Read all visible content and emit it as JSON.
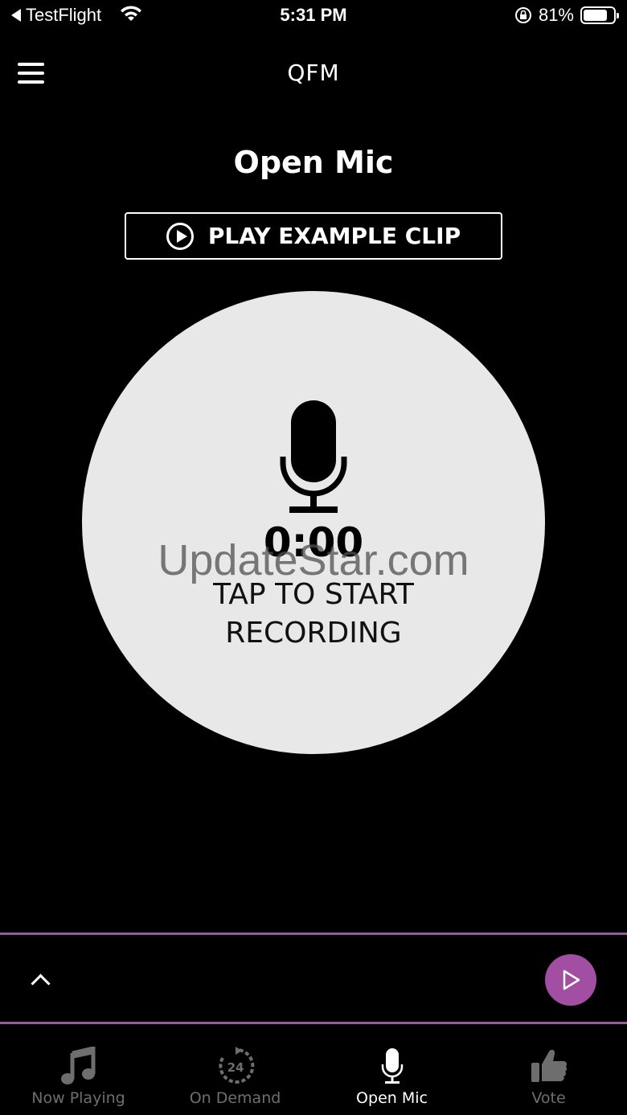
{
  "status_bar": {
    "back_app": "TestFlight",
    "time": "5:31 PM",
    "battery": "81%",
    "battery_level": 0.81
  },
  "nav": {
    "title": "QFM"
  },
  "page": {
    "title": "Open Mic",
    "example_button": "PLAY EXAMPLE CLIP",
    "timer": "0:00",
    "tap_line1": "TAP TO START",
    "tap_line2": "RECORDING",
    "watermark": "UpdateStar.com"
  },
  "tabs": [
    {
      "label": "Now Playing",
      "icon": "music-note-icon",
      "active": false
    },
    {
      "label": "On Demand",
      "icon": "on-demand-24-icon",
      "active": false
    },
    {
      "label": "Open Mic",
      "icon": "microphone-icon",
      "active": true
    },
    {
      "label": "Vote",
      "icon": "thumbs-up-icon",
      "active": false
    }
  ],
  "colors": {
    "accent": "#a24fa3",
    "divider": "#9b5a9b",
    "circle": "#e8e8e8",
    "inactive_tab": "#6e6e6e"
  }
}
